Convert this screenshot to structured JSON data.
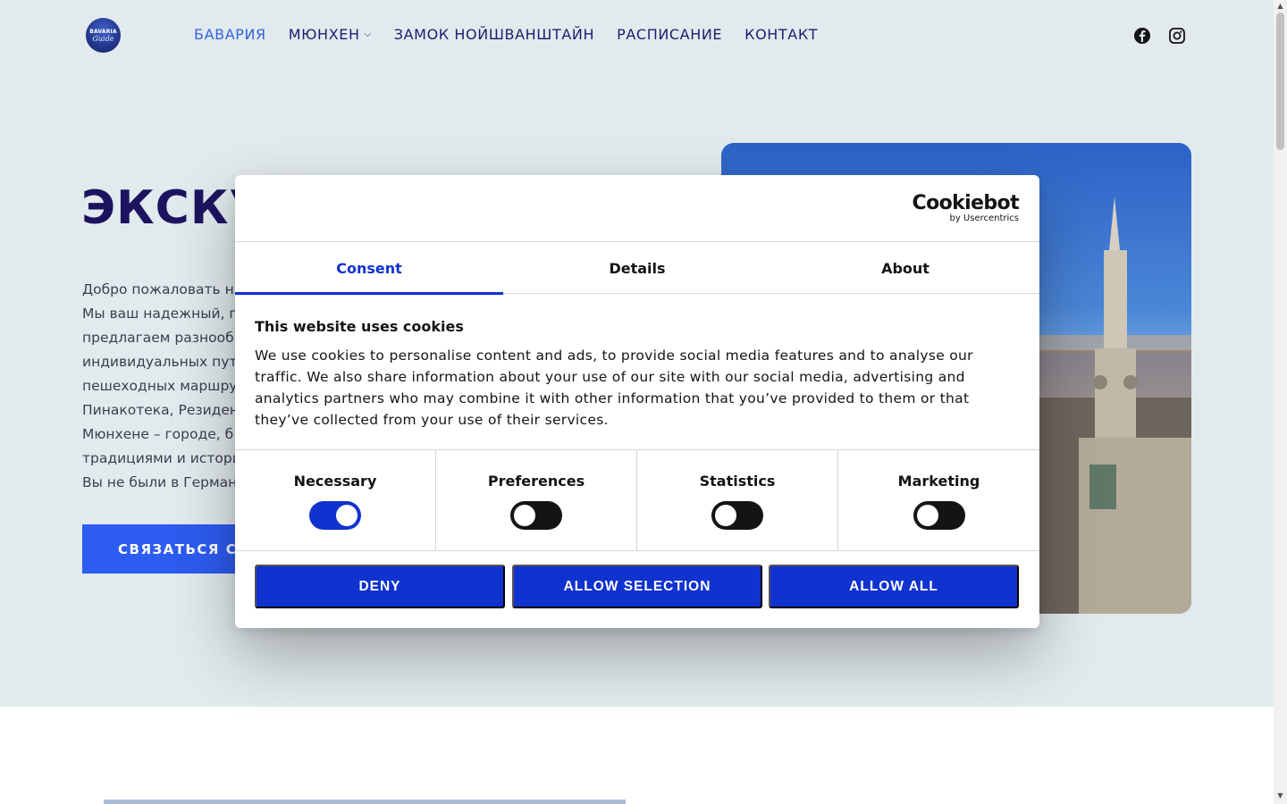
{
  "header": {
    "logo": {
      "line1": "BAVARIA",
      "line2": "Guide"
    },
    "nav": [
      {
        "label": "БАВАРИЯ",
        "active": true
      },
      {
        "label": "МЮНХЕН",
        "has_dropdown": true
      },
      {
        "label": "ЗАМОК НОЙШВАНШТАЙН"
      },
      {
        "label": "РАСПИСАНИЕ"
      },
      {
        "label": "КОНТАКТ"
      }
    ],
    "social": [
      {
        "icon": "facebook-icon"
      },
      {
        "icon": "instagram-icon"
      }
    ]
  },
  "hero": {
    "title": "ЭКСКУР",
    "text_lines": [
      "Добро пожаловать н",
      "Мы ваш надежный, п",
      "предлагаем разнообр",
      "индивидуальных пут",
      "пешеходных маршру",
      "Пинакотека, Резиден",
      "Мюнхене – городе, б",
      "традициями и истори",
      "Вы не были в Герман"
    ],
    "cta_label": "СВЯЗАТЬСЯ С Н"
  },
  "cookie_dialog": {
    "brand": {
      "name": "Cookiebot",
      "sub": "by Usercentrics"
    },
    "tabs": [
      {
        "label": "Consent",
        "active": true
      },
      {
        "label": "Details"
      },
      {
        "label": "About"
      }
    ],
    "heading": "This website uses cookies",
    "body_lines": [
      "We use cookies to personalise content and ads, to provide social media features and to analyse our",
      "traffic. We also share information about your use of our site with our social media, advertising and",
      "analytics partners who may combine it with other information that you’ve provided to them or that",
      "they’ve collected from your use of their services."
    ],
    "toggles": [
      {
        "label": "Necessary",
        "on": true
      },
      {
        "label": "Preferences",
        "on": false
      },
      {
        "label": "Statistics",
        "on": false
      },
      {
        "label": "Marketing",
        "on": false
      }
    ],
    "buttons": {
      "deny": "DENY",
      "allow_selection": "ALLOW SELECTION",
      "allow_all": "ALLOW ALL"
    }
  },
  "colors": {
    "accent": "#1032cf",
    "hero_bg": "#e2eaee",
    "nav_text": "#1a1f6e",
    "cta": "#2d5cf0"
  }
}
